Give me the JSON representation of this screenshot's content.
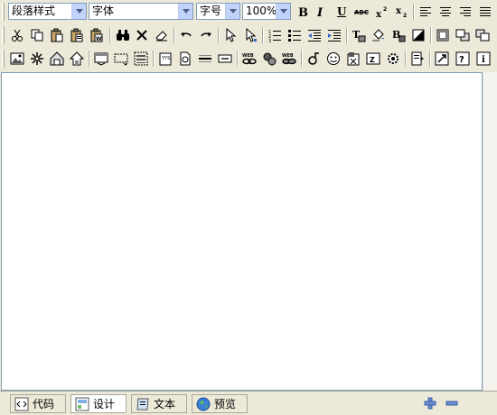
{
  "toolbar1": {
    "paragraph_style": "段落样式",
    "font": "字体",
    "font_size": "字号",
    "zoom": "100%"
  },
  "tabs": [
    {
      "label": "代码"
    },
    {
      "label": "设计"
    },
    {
      "label": "文本"
    },
    {
      "label": "预览"
    }
  ],
  "active_tab": "设计"
}
